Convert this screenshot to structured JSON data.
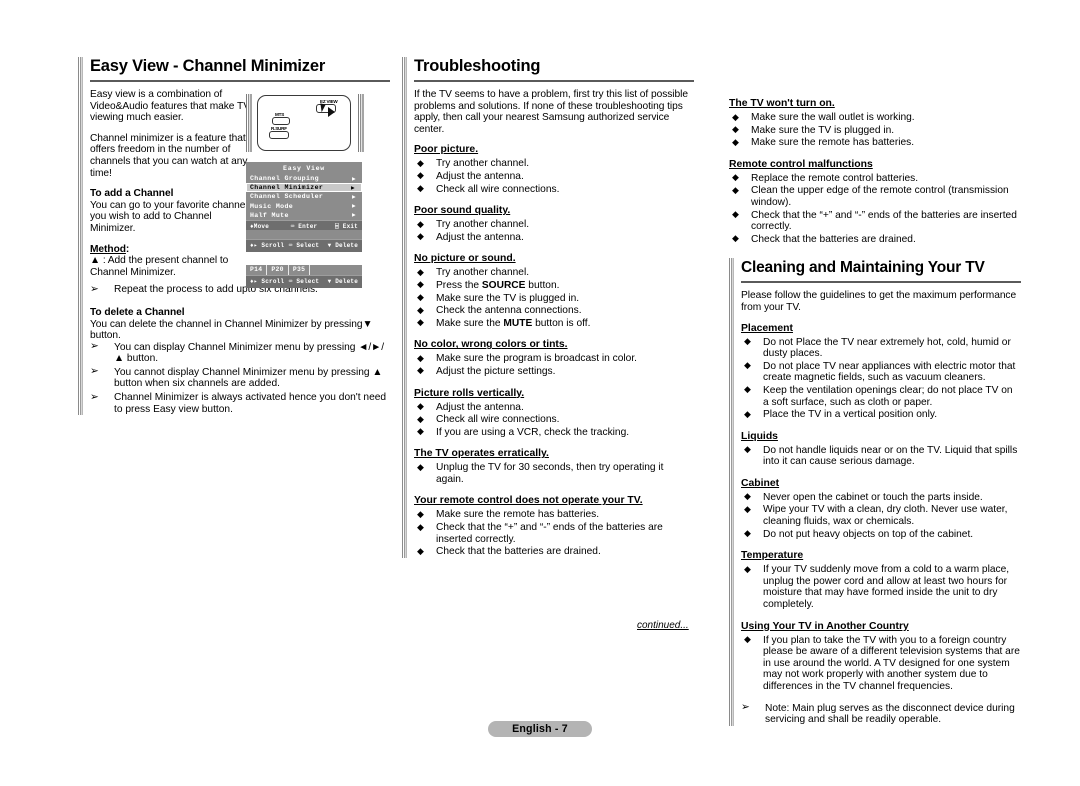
{
  "document": {
    "page_label": "English - 7",
    "continued_note": "continued..."
  },
  "left_column": {
    "heading": "Easy View - Channel Minimizer",
    "intro_1": "Easy view is a combination of Video&Audio features that make TV viewing much easier.",
    "intro_2": "Channel minimizer is a feature that offers freedom in the number of channels that you can watch at any time!",
    "add_heading": "To add a Channel",
    "add_text": "You can go to your favorite channel you wish to add to Channel Minimizer.",
    "method_label": "Method",
    "method_colon": ":",
    "method_text": "▲ : Add the present channel to Channel Minimizer.",
    "repeat_note": "Repeat the process to add upto six channels.",
    "delete_heading": "To delete a Channel",
    "delete_text": "You can delete the channel in Channel Minimizer by pressing▼ button.",
    "delete_notes": [
      "You can display Channel Minimizer menu by pressing ◄/►/▲ button.",
      "You cannot display Channel Minimizer menu by pressing ▲ button when six channels are added.",
      "Channel Minimizer is always activated hence you don't need to press Easy view button."
    ],
    "remote": {
      "button_labels": [
        "MTS",
        "R.SURF",
        "EZ VIEW"
      ]
    },
    "osd_menu": {
      "title": "Easy View",
      "items": [
        "Channel Grouping",
        "Channel Minimizer",
        "Channel Scheduler",
        "Music Mode",
        "Half Mute"
      ],
      "selected_index": 1,
      "arrow_glyph": "▶",
      "footer": [
        "♦Move",
        "⌨ Enter",
        "⌸ Exit"
      ]
    },
    "osd_empty": {
      "footer": [
        "♦▸ Scroll",
        "⌨ Select",
        "▼ Delete"
      ]
    },
    "osd_channels": {
      "channels": [
        "P14",
        "P20",
        "P35"
      ],
      "footer": [
        "♦▸ Scroll",
        "⌨ Select",
        "▼ Delete"
      ]
    }
  },
  "middle_column": {
    "heading": "Troubleshooting",
    "intro": "If the TV seems to have a problem, first try this list of possible problems and solutions. If none of these troubleshooting tips apply, then call your nearest Samsung authorized service center.",
    "sections": [
      {
        "title": "Poor picture.",
        "items": [
          "Try another channel.",
          "Adjust the antenna.",
          "Check all wire connections."
        ]
      },
      {
        "title": "Poor sound quality.",
        "items": [
          "Try another channel.",
          "Adjust the antenna."
        ]
      },
      {
        "title": "No picture or sound.",
        "items": [
          "Try another channel.",
          "Press the SOURCE button.",
          "Make sure the TV is plugged in.",
          "Check the antenna connections.",
          "Make sure the MUTE button is off."
        ]
      },
      {
        "title": "No color, wrong colors or tints.",
        "items": [
          "Make sure the program is broadcast in color.",
          "Adjust the picture settings."
        ]
      },
      {
        "title": "Picture rolls vertically.",
        "items": [
          "Adjust the antenna.",
          "Check all wire connections.",
          "If you are using a VCR, check the tracking."
        ]
      },
      {
        "title": "The TV operates erratically.",
        "items": [
          "Unplug the TV for 30 seconds, then try operating it again."
        ]
      },
      {
        "title": "Your remote control does not operate your TV.",
        "items": [
          "Make sure the remote has batteries.",
          "Check that the “+” and “-” ends of the batteries are inserted correctly.",
          "Check that the batteries are drained."
        ]
      }
    ]
  },
  "right_column": {
    "troubleshooting_cont": [
      {
        "title": "The TV won't turn on.",
        "items": [
          "Make sure the wall outlet is working.",
          "Make sure the TV is plugged in.",
          "Make sure the remote has batteries."
        ]
      },
      {
        "title": "Remote control malfunctions",
        "items": [
          "Replace the remote control batteries.",
          "Clean the upper edge of the remote control (transmission window).",
          "Check that the “+” and “-” ends of the batteries are inserted correctly.",
          "Check that the batteries are drained."
        ]
      }
    ],
    "heading": "Cleaning and Maintaining Your TV",
    "intro": "Please follow the guidelines to get the maximum performance from your TV.",
    "sections": [
      {
        "title": "Placement",
        "items": [
          "Do not Place the TV near extremely hot, cold, humid or dusty places.",
          "Do not place TV near appliances with electric motor that create magnetic fields, such as vacuum cleaners.",
          "Keep the ventilation openings clear; do not place TV on a soft surface, such as cloth or paper.",
          "Place the TV in a vertical position only."
        ]
      },
      {
        "title": "Liquids",
        "items": [
          "Do not handle liquids near or on the TV. Liquid that spills into it can cause serious damage."
        ]
      },
      {
        "title": "Cabinet",
        "items": [
          "Never open the cabinet or touch the parts inside.",
          "Wipe your TV with a clean, dry cloth. Never use water, cleaning fluids, wax or chemicals.",
          "Do not put heavy objects on top of the cabinet."
        ]
      },
      {
        "title": "Temperature",
        "items": [
          "If your TV suddenly move from a cold to a warm place, unplug the power cord and allow at least two hours for moisture that may have formed inside the unit to dry completely."
        ]
      },
      {
        "title": "Using Your TV in Another Country",
        "items": [
          "If you plan to take the TV with you to a foreign country please be aware of a different television systems that are in use around the world. A TV designed for one system may not work properly with another system due to differences in the TV channel frequencies."
        ]
      }
    ],
    "final_note": "Note: Main plug serves as the disconnect device during servicing and shall be readily operable."
  }
}
